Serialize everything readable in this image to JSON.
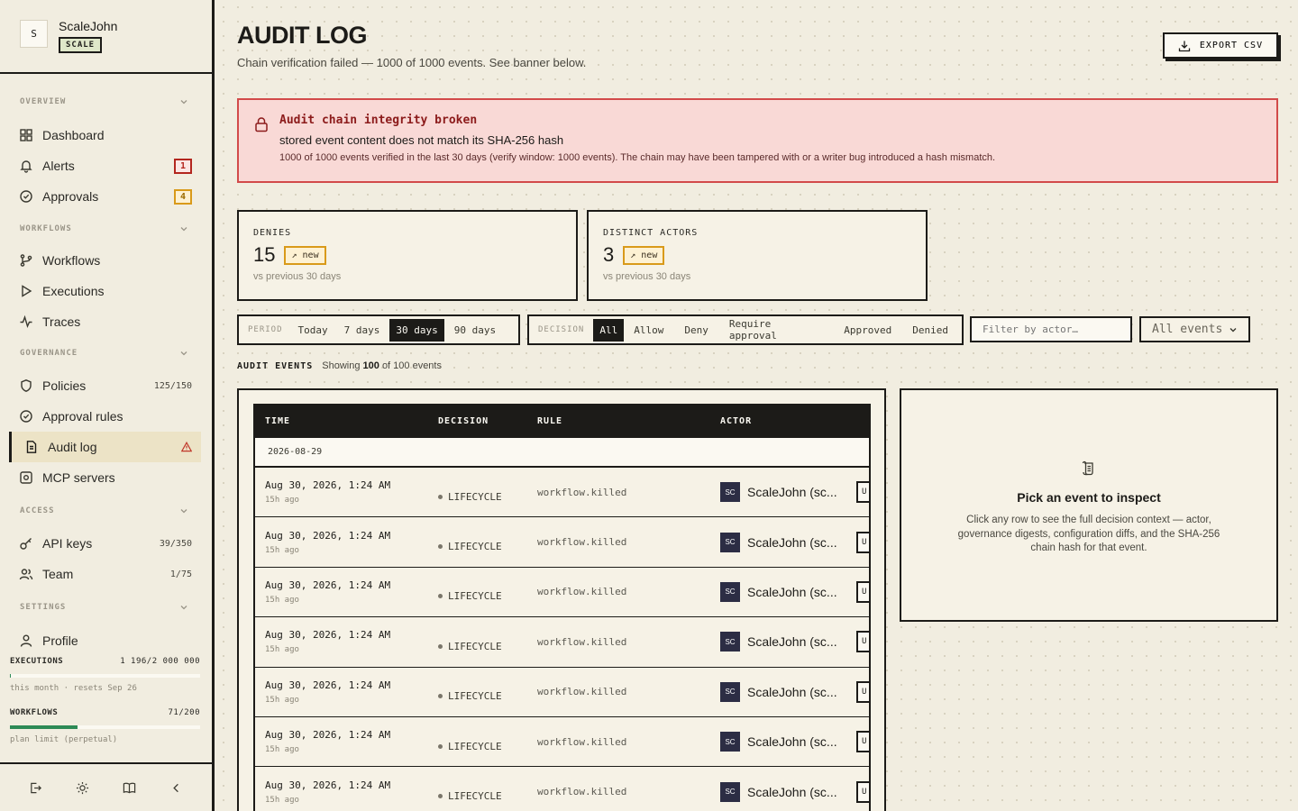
{
  "workspace": {
    "avatar": "S",
    "name": "ScaleJohn",
    "plan_badge": "SCALE"
  },
  "nav": {
    "sections": [
      {
        "id": "overview",
        "label": "OVERVIEW"
      },
      {
        "id": "workflows",
        "label": "WORKFLOWS"
      },
      {
        "id": "governance",
        "label": "GOVERNANCE"
      },
      {
        "id": "access",
        "label": "ACCESS"
      },
      {
        "id": "settings",
        "label": "SETTINGS"
      }
    ],
    "items": {
      "dashboard": {
        "label": "Dashboard",
        "icon": "grid-icon"
      },
      "alerts": {
        "label": "Alerts",
        "icon": "bell-icon",
        "badge": "1"
      },
      "approvals": {
        "label": "Approvals",
        "icon": "check-circle-icon",
        "badge": "4"
      },
      "workflows": {
        "label": "Workflows",
        "icon": "branch-icon"
      },
      "executions": {
        "label": "Executions",
        "icon": "play-icon"
      },
      "traces": {
        "label": "Traces",
        "icon": "activity-icon"
      },
      "policies": {
        "label": "Policies",
        "icon": "shield-icon",
        "count": "125/150"
      },
      "approval_rules": {
        "label": "Approval rules",
        "icon": "check-circle-icon"
      },
      "audit_log": {
        "label": "Audit log",
        "icon": "document-icon",
        "active": true
      },
      "mcp_servers": {
        "label": "MCP servers",
        "icon": "cog-box-icon"
      },
      "api_keys": {
        "label": "API keys",
        "icon": "key-icon",
        "count": "39/350"
      },
      "team": {
        "label": "Team",
        "icon": "users-icon",
        "count": "1/75"
      },
      "profile": {
        "label": "Profile",
        "icon": "user-icon"
      }
    }
  },
  "usage": {
    "executions": {
      "label": "EXECUTIONS",
      "value": "1 196/2 000 000",
      "fraction": 0.0006,
      "note": "this month · resets Sep 26"
    },
    "workflows": {
      "label": "WORKFLOWS",
      "value": "71/200",
      "fraction": 0.355,
      "note": "plan limit (perpetual)"
    }
  },
  "page": {
    "title": "AUDIT LOG",
    "subtitle": "Chain verification failed — 1000 of 1000 events. See banner below.",
    "export_label": "EXPORT CSV"
  },
  "banner": {
    "title": "Audit chain integrity broken",
    "message": "stored event content does not match its SHA-256 hash",
    "detail": "1000 of 1000 events verified in the last 30 days (verify window: 1000 events). The chain may have been tampered with or a writer bug introduced a hash mismatch."
  },
  "stats": {
    "denies": {
      "label": "DENIES",
      "value": "15",
      "chip": "↗ new",
      "note": "vs previous 30 days"
    },
    "actors": {
      "label": "DISTINCT ACTORS",
      "value": "3",
      "chip": "↗ new",
      "note": "vs previous 30 days"
    }
  },
  "filters": {
    "period": {
      "label": "PERIOD",
      "options": [
        "Today",
        "7 days",
        "30 days",
        "90 days"
      ],
      "selected": "30 days"
    },
    "decision": {
      "label": "DECISION",
      "options": [
        "All",
        "Allow",
        "Deny",
        "Require approval",
        "Approved",
        "Denied"
      ],
      "selected": "All"
    },
    "actor_placeholder": "Filter by actor…",
    "event_type": "All events"
  },
  "events": {
    "heading": "AUDIT EVENTS",
    "showing_prefix": "Showing",
    "showing_count": "100",
    "showing_suffix": "of 100 events",
    "columns": {
      "time": "TIME",
      "decision": "DECISION",
      "rule": "RULE",
      "actor": "ACTOR"
    },
    "group_date": "2026-08-29",
    "rows": [
      {
        "time": "Aug 30, 2026, 1:24 AM",
        "ago": "15h ago",
        "decision": "LIFECYCLE",
        "rule": "workflow.killed",
        "actor_initials": "SC",
        "actor": "ScaleJohn (sc...",
        "tag": "U"
      },
      {
        "time": "Aug 30, 2026, 1:24 AM",
        "ago": "15h ago",
        "decision": "LIFECYCLE",
        "rule": "workflow.killed",
        "actor_initials": "SC",
        "actor": "ScaleJohn (sc...",
        "tag": "U"
      },
      {
        "time": "Aug 30, 2026, 1:24 AM",
        "ago": "15h ago",
        "decision": "LIFECYCLE",
        "rule": "workflow.killed",
        "actor_initials": "SC",
        "actor": "ScaleJohn (sc...",
        "tag": "U"
      },
      {
        "time": "Aug 30, 2026, 1:24 AM",
        "ago": "15h ago",
        "decision": "LIFECYCLE",
        "rule": "workflow.killed",
        "actor_initials": "SC",
        "actor": "ScaleJohn (sc...",
        "tag": "U"
      },
      {
        "time": "Aug 30, 2026, 1:24 AM",
        "ago": "15h ago",
        "decision": "LIFECYCLE",
        "rule": "workflow.killed",
        "actor_initials": "SC",
        "actor": "ScaleJohn (sc...",
        "tag": "U"
      },
      {
        "time": "Aug 30, 2026, 1:24 AM",
        "ago": "15h ago",
        "decision": "LIFECYCLE",
        "rule": "workflow.killed",
        "actor_initials": "SC",
        "actor": "ScaleJohn (sc...",
        "tag": "U"
      },
      {
        "time": "Aug 30, 2026, 1:24 AM",
        "ago": "15h ago",
        "decision": "LIFECYCLE",
        "rule": "workflow.killed",
        "actor_initials": "SC",
        "actor": "ScaleJohn (sc...",
        "tag": "U"
      }
    ]
  },
  "inspector": {
    "icon": "scroll-icon",
    "title": "Pick an event to inspect",
    "body": "Click any row to see the full decision context — actor, governance digests, configuration diffs, and the SHA-256 chain hash for that event."
  }
}
